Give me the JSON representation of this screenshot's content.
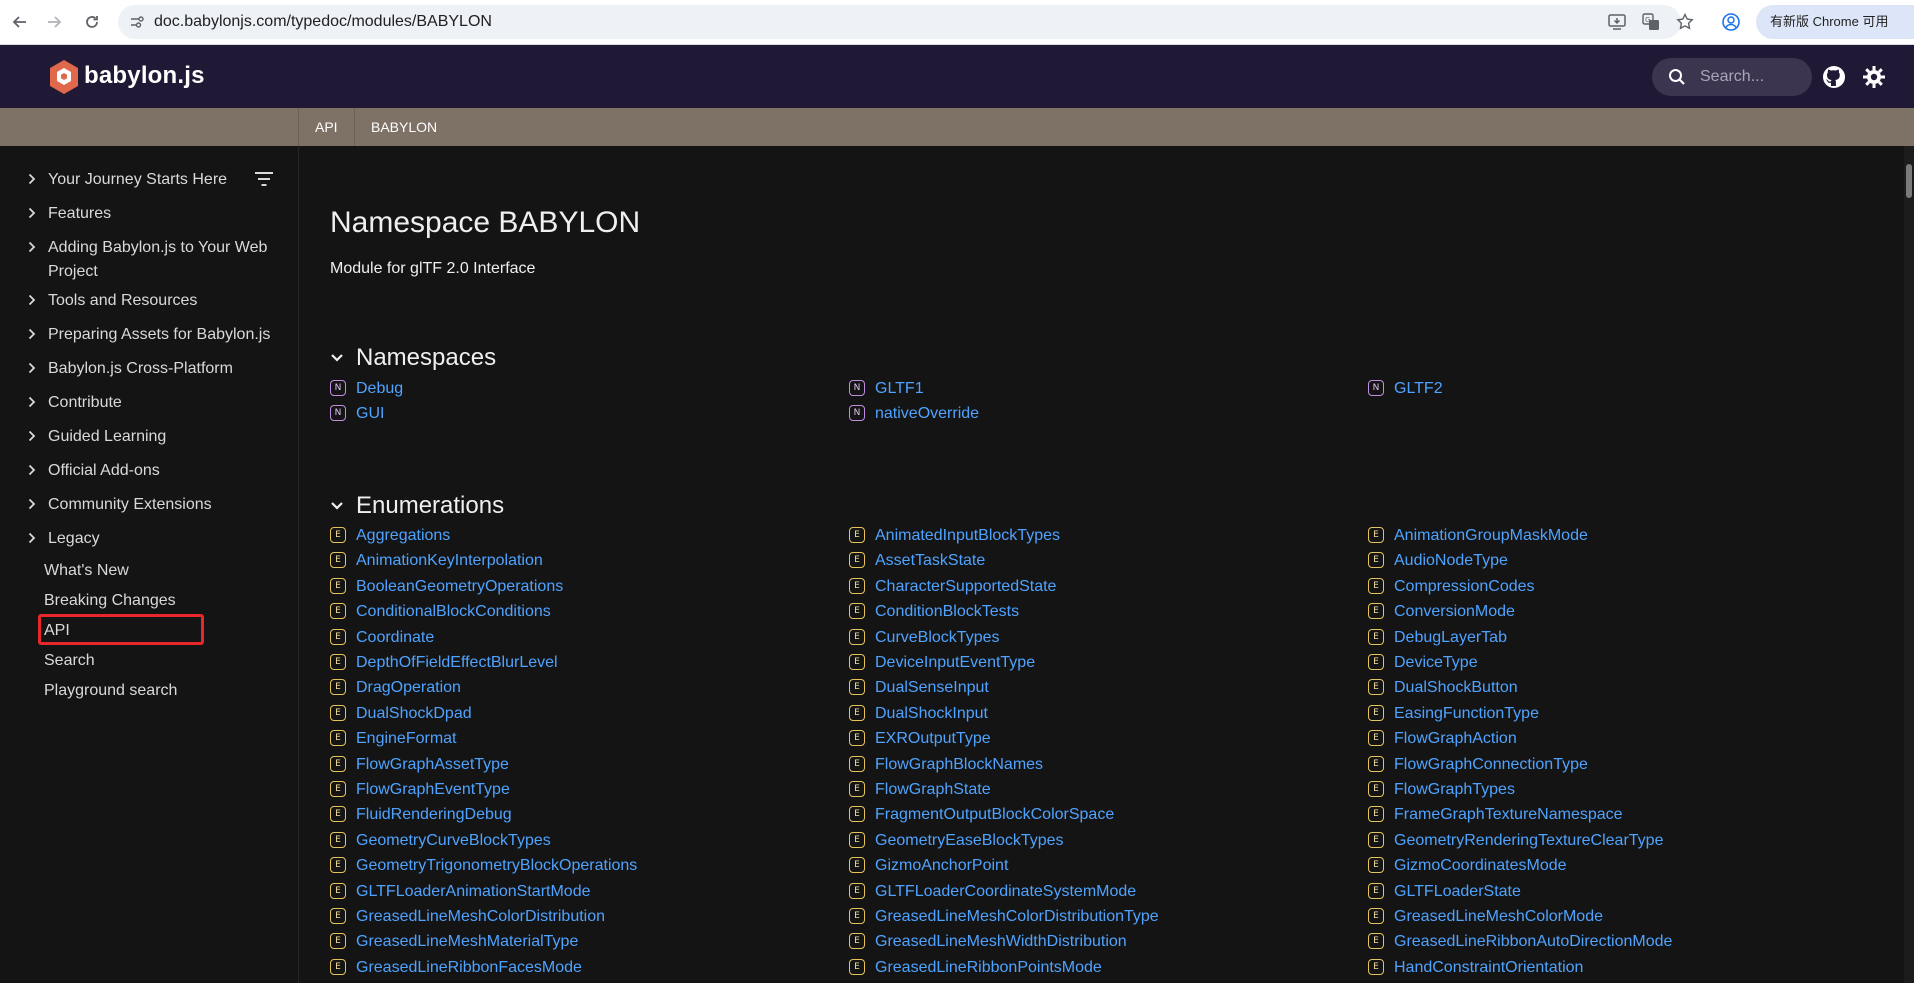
{
  "browser": {
    "url": "doc.babylonjs.com/typedoc/modules/BABYLON",
    "update_label": "有新版 Chrome 可用"
  },
  "header": {
    "logo_text": "babylon.js",
    "search_placeholder": "Search..."
  },
  "breadcrumbs": [
    "API",
    "BABYLON"
  ],
  "sidebar": {
    "items": [
      {
        "label": "Your Journey Starts Here"
      },
      {
        "label": "Features"
      },
      {
        "label": "Adding Babylon.js to Your Web Project"
      },
      {
        "label": "Tools and Resources"
      },
      {
        "label": "Preparing Assets for Babylon.js"
      },
      {
        "label": "Babylon.js Cross-Platform"
      },
      {
        "label": "Contribute"
      },
      {
        "label": "Guided Learning"
      },
      {
        "label": "Official Add-ons"
      },
      {
        "label": "Community Extensions"
      },
      {
        "label": "Legacy"
      }
    ],
    "links": [
      "What's New",
      "Breaking Changes",
      "API",
      "Search",
      "Playground search"
    ]
  },
  "main": {
    "title": "Namespace BABYLON",
    "subtitle": "Module for glTF 2.0 Interface",
    "namespaces_heading": "Namespaces",
    "namespace_badge": "N",
    "namespaces": [
      [
        "Debug",
        "GLTF1",
        "GLTF2"
      ],
      [
        "GUI",
        "nativeOverride"
      ]
    ],
    "enumerations_heading": "Enumerations",
    "enum_badge": "E",
    "enumerations": [
      [
        "Aggregations",
        "AnimatedInputBlockTypes",
        "AnimationGroupMaskMode"
      ],
      [
        "AnimationKeyInterpolation",
        "AssetTaskState",
        "AudioNodeType"
      ],
      [
        "BooleanGeometryOperations",
        "CharacterSupportedState",
        "CompressionCodes"
      ],
      [
        "ConditionalBlockConditions",
        "ConditionBlockTests",
        "ConversionMode"
      ],
      [
        "Coordinate",
        "CurveBlockTypes",
        "DebugLayerTab"
      ],
      [
        "DepthOfFieldEffectBlurLevel",
        "DeviceInputEventType",
        "DeviceType"
      ],
      [
        "DragOperation",
        "DualSenseInput",
        "DualShockButton"
      ],
      [
        "DualShockDpad",
        "DualShockInput",
        "EasingFunctionType"
      ],
      [
        "EngineFormat",
        "EXROutputType",
        "FlowGraphAction"
      ],
      [
        "FlowGraphAssetType",
        "FlowGraphBlockNames",
        "FlowGraphConnectionType"
      ],
      [
        "FlowGraphEventType",
        "FlowGraphState",
        "FlowGraphTypes"
      ],
      [
        "FluidRenderingDebug",
        "FragmentOutputBlockColorSpace",
        "FrameGraphTextureNamespace"
      ],
      [
        "GeometryCurveBlockTypes",
        "GeometryEaseBlockTypes",
        "GeometryRenderingTextureClearType"
      ],
      [
        "GeometryTrigonometryBlockOperations",
        "GizmoAnchorPoint",
        "GizmoCoordinatesMode"
      ],
      [
        "GLTFLoaderAnimationStartMode",
        "GLTFLoaderCoordinateSystemMode",
        "GLTFLoaderState"
      ],
      [
        "GreasedLineMeshColorDistribution",
        "GreasedLineMeshColorDistributionType",
        "GreasedLineMeshColorMode"
      ],
      [
        "GreasedLineMeshMaterialType",
        "GreasedLineMeshWidthDistribution",
        "GreasedLineRibbonAutoDirectionMode"
      ],
      [
        "GreasedLineRibbonFacesMode",
        "GreasedLineRibbonPointsMode",
        "HandConstraintOrientation"
      ]
    ]
  }
}
